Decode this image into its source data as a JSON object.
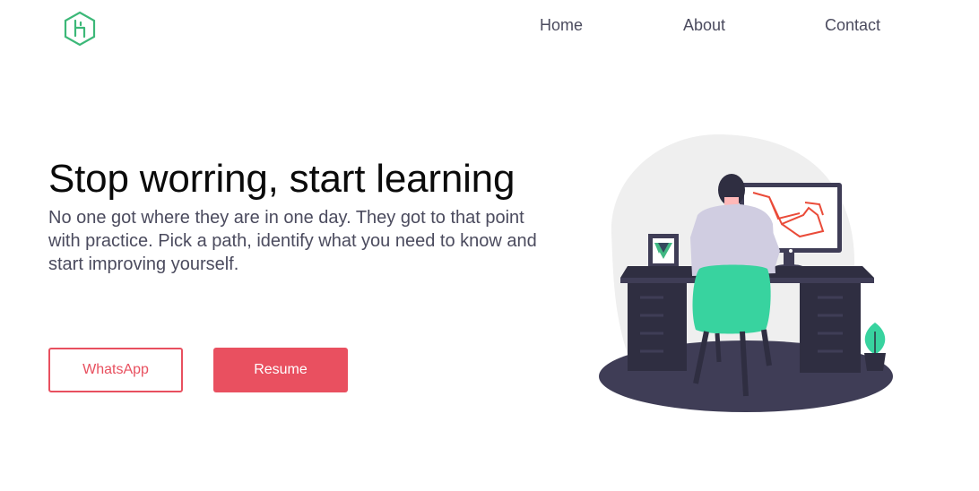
{
  "header": {
    "logo_icon": "hexagon-h-logo-icon",
    "nav": {
      "home": "Home",
      "about": "About",
      "contact": "Contact"
    }
  },
  "hero": {
    "title": "Stop worring, start learning",
    "description": "No one got where they are in one day. They got to that point with practice. Pick a path, identify what you need to know and start improving yourself.",
    "buttons": {
      "whatsapp": "WhatsApp",
      "resume": "Resume"
    },
    "illustration_icon": "person-at-desk-illustration"
  },
  "colors": {
    "accent": "#e95060",
    "logo": "#3cb878",
    "text_dark": "#0a0a0a",
    "text_muted": "#4b4b5e",
    "desk": "#3f3d56",
    "chair": "#38d39f"
  }
}
